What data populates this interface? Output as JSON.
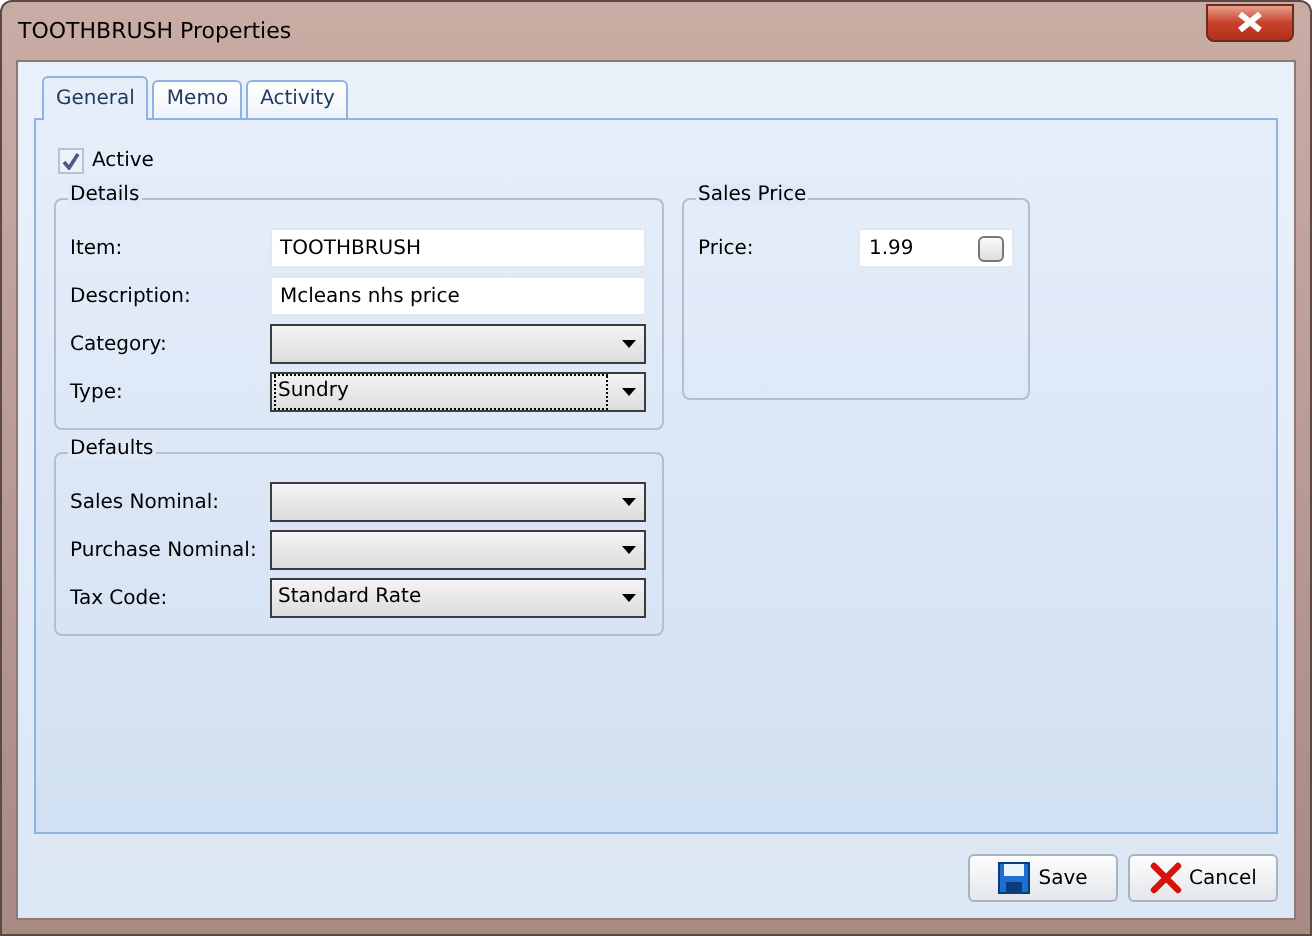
{
  "window": {
    "title": "TOOTHBRUSH Properties"
  },
  "tabs": [
    {
      "label": "General",
      "selected": true
    },
    {
      "label": "Memo",
      "selected": false
    },
    {
      "label": "Activity",
      "selected": false
    }
  ],
  "active": {
    "label": "Active",
    "checked": true
  },
  "details": {
    "title": "Details",
    "fields": [
      {
        "label": "Item:",
        "kind": "text",
        "value": "TOOTHBRUSH",
        "focused": false
      },
      {
        "label": "Description:",
        "kind": "text",
        "value": "Mcleans nhs price",
        "focused": false
      },
      {
        "label": "Category:",
        "kind": "dropdown",
        "focused": false
      },
      {
        "label": "Type:",
        "kind": "dropdown",
        "value": "Sundry",
        "focused": true
      }
    ]
  },
  "defaults": {
    "title": "Defaults",
    "fields": [
      {
        "label": "Sales Nominal:",
        "kind": "dropdown",
        "focused": false
      },
      {
        "label": "Purchase Nominal:",
        "kind": "dropdown",
        "focused": false
      },
      {
        "label": "Tax Code:",
        "kind": "dropdown",
        "value": "Standard Rate",
        "focused": false
      }
    ]
  },
  "sales_price": {
    "title": "Sales Price",
    "fields": [
      {
        "label": "Price:",
        "kind": "spin",
        "value": "1.99",
        "focused": false
      }
    ]
  },
  "buttons": [
    {
      "label": "Save",
      "kind": "save"
    },
    {
      "label": "Cancel",
      "kind": "cancel"
    }
  ]
}
